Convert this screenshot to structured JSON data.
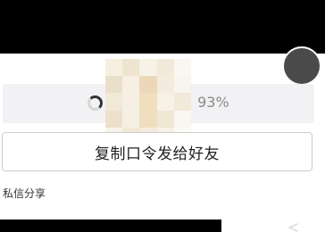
{
  "progress": {
    "percent_text": "93%",
    "value": 0.93
  },
  "actions": {
    "copy_button_label": "复制口令发给好友"
  },
  "section": {
    "title": "私信分享"
  },
  "colors": {
    "background": "#000000",
    "sheet": "#ffffff",
    "progress_track": "#f2f2f4",
    "muted_text": "#8a8a8a",
    "primary_text": "#222222"
  },
  "icons": {
    "loading": "spinner-icon",
    "top_right": "avatar-button-icon",
    "bottom_right": "back-arrow-icon"
  }
}
